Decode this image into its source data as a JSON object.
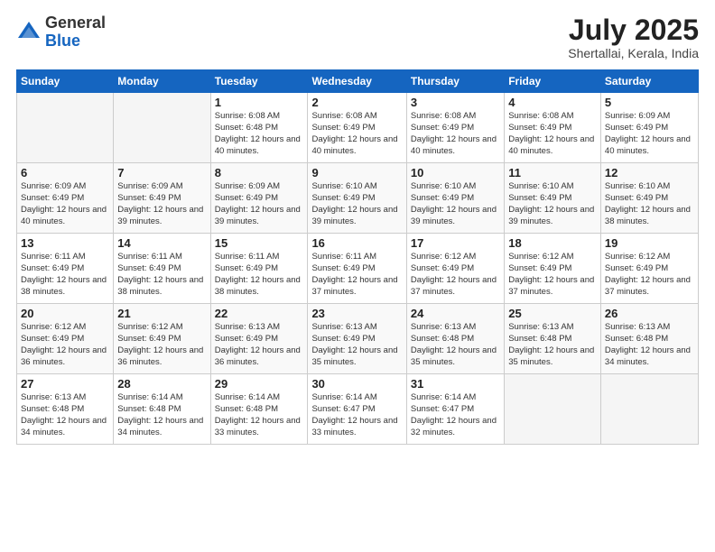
{
  "logo": {
    "general": "General",
    "blue": "Blue"
  },
  "header": {
    "month_year": "July 2025",
    "location": "Shertallai, Kerala, India"
  },
  "days_of_week": [
    "Sunday",
    "Monday",
    "Tuesday",
    "Wednesday",
    "Thursday",
    "Friday",
    "Saturday"
  ],
  "weeks": [
    [
      {
        "day": "",
        "info": ""
      },
      {
        "day": "",
        "info": ""
      },
      {
        "day": "1",
        "info": "Sunrise: 6:08 AM\nSunset: 6:48 PM\nDaylight: 12 hours and 40 minutes."
      },
      {
        "day": "2",
        "info": "Sunrise: 6:08 AM\nSunset: 6:49 PM\nDaylight: 12 hours and 40 minutes."
      },
      {
        "day": "3",
        "info": "Sunrise: 6:08 AM\nSunset: 6:49 PM\nDaylight: 12 hours and 40 minutes."
      },
      {
        "day": "4",
        "info": "Sunrise: 6:08 AM\nSunset: 6:49 PM\nDaylight: 12 hours and 40 minutes."
      },
      {
        "day": "5",
        "info": "Sunrise: 6:09 AM\nSunset: 6:49 PM\nDaylight: 12 hours and 40 minutes."
      }
    ],
    [
      {
        "day": "6",
        "info": "Sunrise: 6:09 AM\nSunset: 6:49 PM\nDaylight: 12 hours and 40 minutes."
      },
      {
        "day": "7",
        "info": "Sunrise: 6:09 AM\nSunset: 6:49 PM\nDaylight: 12 hours and 39 minutes."
      },
      {
        "day": "8",
        "info": "Sunrise: 6:09 AM\nSunset: 6:49 PM\nDaylight: 12 hours and 39 minutes."
      },
      {
        "day": "9",
        "info": "Sunrise: 6:10 AM\nSunset: 6:49 PM\nDaylight: 12 hours and 39 minutes."
      },
      {
        "day": "10",
        "info": "Sunrise: 6:10 AM\nSunset: 6:49 PM\nDaylight: 12 hours and 39 minutes."
      },
      {
        "day": "11",
        "info": "Sunrise: 6:10 AM\nSunset: 6:49 PM\nDaylight: 12 hours and 39 minutes."
      },
      {
        "day": "12",
        "info": "Sunrise: 6:10 AM\nSunset: 6:49 PM\nDaylight: 12 hours and 38 minutes."
      }
    ],
    [
      {
        "day": "13",
        "info": "Sunrise: 6:11 AM\nSunset: 6:49 PM\nDaylight: 12 hours and 38 minutes."
      },
      {
        "day": "14",
        "info": "Sunrise: 6:11 AM\nSunset: 6:49 PM\nDaylight: 12 hours and 38 minutes."
      },
      {
        "day": "15",
        "info": "Sunrise: 6:11 AM\nSunset: 6:49 PM\nDaylight: 12 hours and 38 minutes."
      },
      {
        "day": "16",
        "info": "Sunrise: 6:11 AM\nSunset: 6:49 PM\nDaylight: 12 hours and 37 minutes."
      },
      {
        "day": "17",
        "info": "Sunrise: 6:12 AM\nSunset: 6:49 PM\nDaylight: 12 hours and 37 minutes."
      },
      {
        "day": "18",
        "info": "Sunrise: 6:12 AM\nSunset: 6:49 PM\nDaylight: 12 hours and 37 minutes."
      },
      {
        "day": "19",
        "info": "Sunrise: 6:12 AM\nSunset: 6:49 PM\nDaylight: 12 hours and 37 minutes."
      }
    ],
    [
      {
        "day": "20",
        "info": "Sunrise: 6:12 AM\nSunset: 6:49 PM\nDaylight: 12 hours and 36 minutes."
      },
      {
        "day": "21",
        "info": "Sunrise: 6:12 AM\nSunset: 6:49 PM\nDaylight: 12 hours and 36 minutes."
      },
      {
        "day": "22",
        "info": "Sunrise: 6:13 AM\nSunset: 6:49 PM\nDaylight: 12 hours and 36 minutes."
      },
      {
        "day": "23",
        "info": "Sunrise: 6:13 AM\nSunset: 6:49 PM\nDaylight: 12 hours and 35 minutes."
      },
      {
        "day": "24",
        "info": "Sunrise: 6:13 AM\nSunset: 6:48 PM\nDaylight: 12 hours and 35 minutes."
      },
      {
        "day": "25",
        "info": "Sunrise: 6:13 AM\nSunset: 6:48 PM\nDaylight: 12 hours and 35 minutes."
      },
      {
        "day": "26",
        "info": "Sunrise: 6:13 AM\nSunset: 6:48 PM\nDaylight: 12 hours and 34 minutes."
      }
    ],
    [
      {
        "day": "27",
        "info": "Sunrise: 6:13 AM\nSunset: 6:48 PM\nDaylight: 12 hours and 34 minutes."
      },
      {
        "day": "28",
        "info": "Sunrise: 6:14 AM\nSunset: 6:48 PM\nDaylight: 12 hours and 34 minutes."
      },
      {
        "day": "29",
        "info": "Sunrise: 6:14 AM\nSunset: 6:48 PM\nDaylight: 12 hours and 33 minutes."
      },
      {
        "day": "30",
        "info": "Sunrise: 6:14 AM\nSunset: 6:47 PM\nDaylight: 12 hours and 33 minutes."
      },
      {
        "day": "31",
        "info": "Sunrise: 6:14 AM\nSunset: 6:47 PM\nDaylight: 12 hours and 32 minutes."
      },
      {
        "day": "",
        "info": ""
      },
      {
        "day": "",
        "info": ""
      }
    ]
  ]
}
